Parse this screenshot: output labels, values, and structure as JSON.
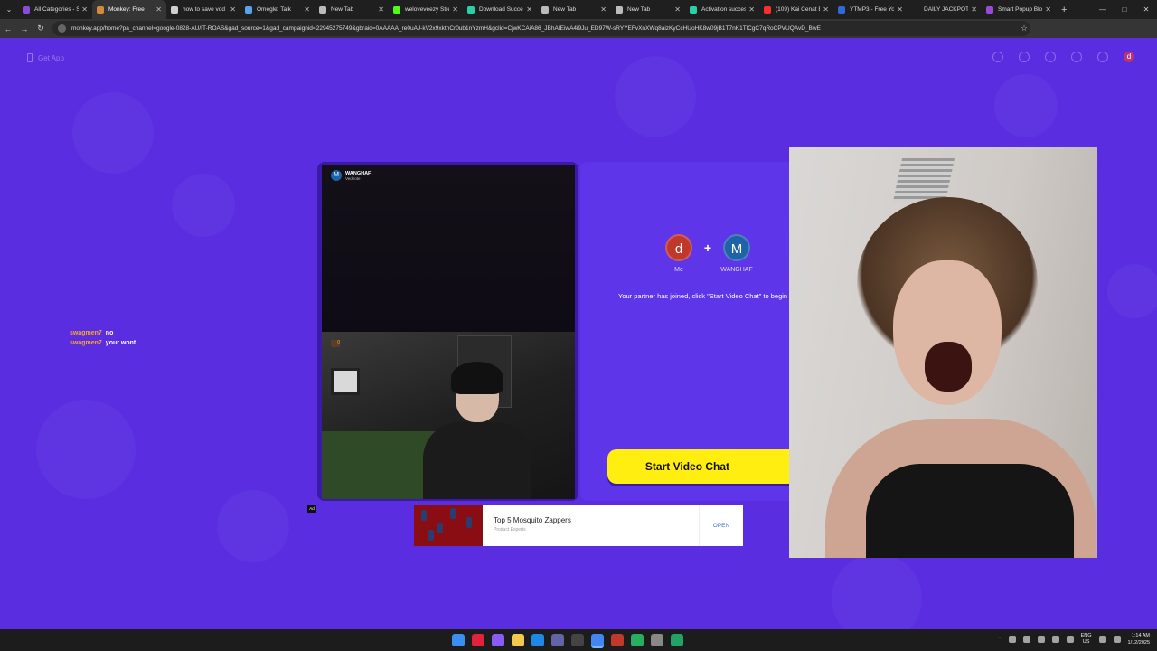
{
  "browser": {
    "tabs": [
      {
        "title": "All Categories - S",
        "color": "#8a4bd6",
        "active": false
      },
      {
        "title": "Monkey: Free",
        "color": "#d28b3b",
        "active": true
      },
      {
        "title": "how to save vod",
        "color": "#cfcfcf",
        "active": false
      },
      {
        "title": "Omegle: Talk",
        "color": "#58a4e8",
        "active": false
      },
      {
        "title": "New Tab",
        "color": "#bbbbbb",
        "active": false
      },
      {
        "title": "weloveveezy Stre",
        "color": "#53fc18",
        "active": false
      },
      {
        "title": "Download Succes",
        "color": "#2ad0a7",
        "active": false
      },
      {
        "title": "New Tab",
        "color": "#bbbbbb",
        "active": false
      },
      {
        "title": "New Tab",
        "color": "#bbbbbb",
        "active": false
      },
      {
        "title": "Activation succes",
        "color": "#2ad0a7",
        "active": false
      },
      {
        "title": "(109) Kai Cenat B",
        "color": "#ff2d2d",
        "active": false
      },
      {
        "title": "YTMP3 - Free Yo",
        "color": "#2f68d8",
        "active": false
      },
      {
        "title": "DAILY JACKPOTS!",
        "color": "#1f1f1f",
        "active": false
      },
      {
        "title": "Smart Popup Blo",
        "color": "#9a4bd6",
        "active": false
      }
    ],
    "url": "monkey.app/home?pa_channel=google-0828-AU/IT-ROAS&gad_source=1&gad_campaignid=22945275749&gbraid=0AAAAA_re0uAJ-kV2x9xkthCr0ub1nYzmH&gclid=CjwKCAiA86_JBhAIEiwA4i9Ju_ED97W-sRYYEFvXnXWq8aizKyCcHUoHK8w09jB1T7nK1TlCgC7qRoCPVUQAvD_BwE",
    "colors": {
      "ext1": "#e3632d",
      "ext2": "#dcdcdc",
      "ext3": "#aaaaaa",
      "ext4": "#aaaaaa",
      "profile": "#7b3fd1"
    }
  },
  "page": {
    "get_app": "Get App",
    "profile_initial": "d",
    "chat": [
      {
        "user": "swagmen7",
        "message": "no"
      },
      {
        "user": "swagmen7",
        "message": "your wont"
      }
    ],
    "partner": {
      "name": "WANGHAF",
      "sub": "Vedeote",
      "initial": "M"
    },
    "self_badge": "0",
    "match": {
      "me_initial": "d",
      "me_label": "Me",
      "me_color": "#c0382b",
      "partner_initial": "M",
      "partner_label": "WANGHAF",
      "partner_color": "#1e63a8",
      "plus": "+",
      "message": "Your partner has joined, click \"Start Video Chat\" to begin"
    },
    "start_button": "Start Video Chat",
    "ad": {
      "badge": "Ad",
      "title": "Top 5 Mosquito Zappers",
      "source": "Product Experts",
      "cta": "OPEN"
    }
  },
  "taskbar": {
    "lang_top": "ENG",
    "lang_bottom": "US",
    "time": "1:14 AM",
    "date": "1/12/2025",
    "app_colors": [
      "#3b8ff3",
      "#e0223b",
      "#8a5cf5",
      "#f2c94c",
      "#1e88e5",
      "#6264a7",
      "#444444",
      "#4285f4",
      "#c0392b",
      "#27ae60",
      "#888888",
      "#21a366"
    ]
  }
}
